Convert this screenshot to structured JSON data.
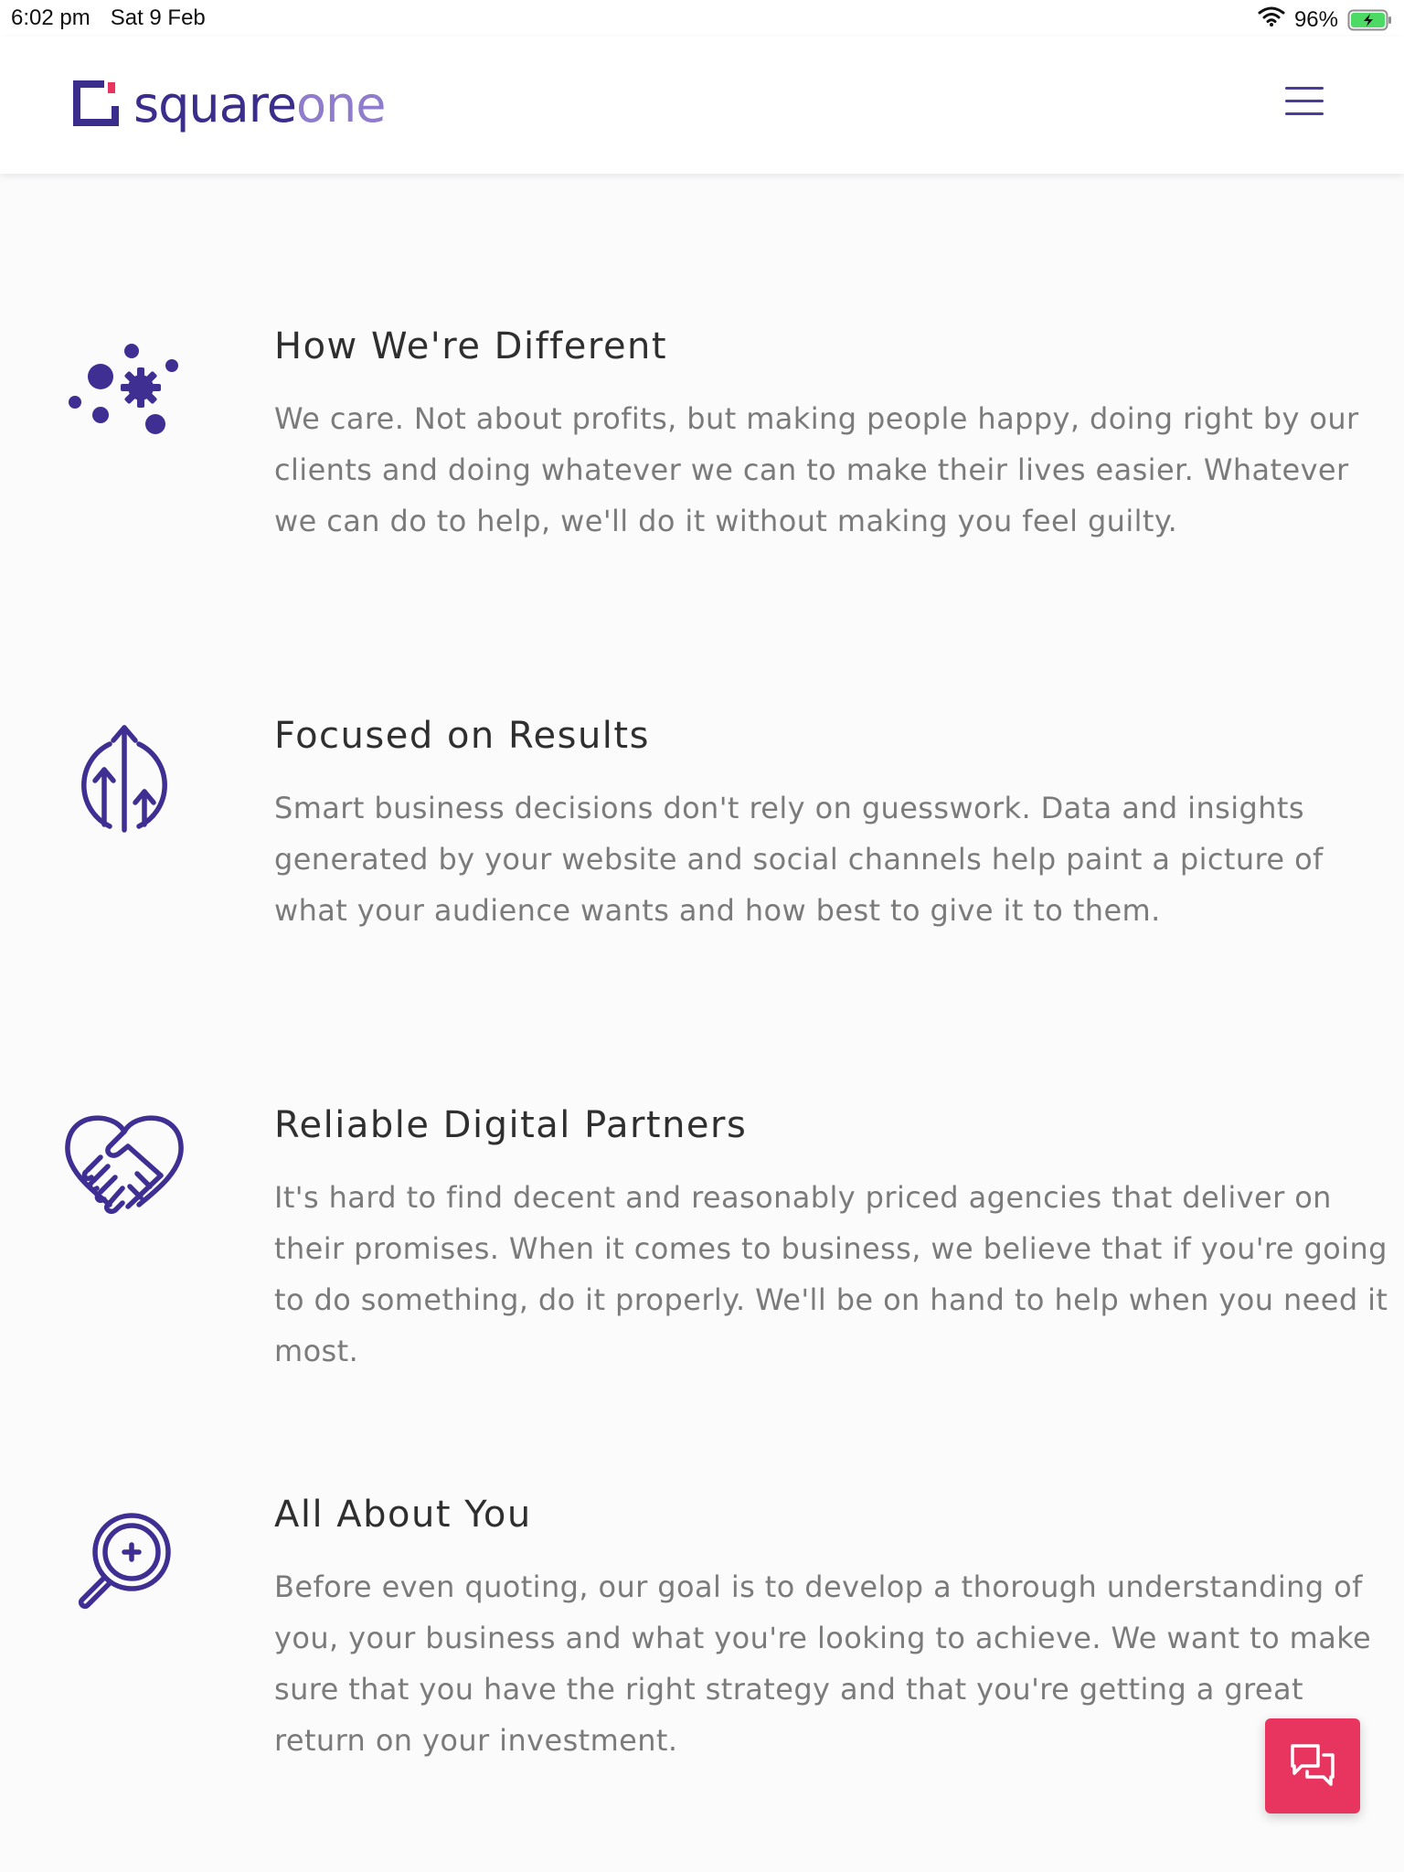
{
  "status_bar": {
    "time": "6:02 pm",
    "date": "Sat 9 Feb",
    "battery_percent": "96%",
    "battery_level": 0.96,
    "battery_charging": true
  },
  "header": {
    "logo": {
      "word1": "square",
      "word2": "one",
      "mark_color": "#3a2d8c",
      "accent_color": "#e8355f"
    },
    "menu_icon": "hamburger-icon"
  },
  "features": [
    {
      "icon": "network-dots-icon",
      "title": "How We're Different",
      "body": "We care. Not about profits, but making people happy, doing right by our clients and doing whatever we can to make their lives easier. Whatever we can do to help, we'll do it without making you feel guilty."
    },
    {
      "icon": "growth-arrows-icon",
      "title": "Focused on Results",
      "body": "Smart business decisions don't rely on guesswork. Data and insights generated by your website and social channels help paint a picture of what your audience wants and how best to give it to them."
    },
    {
      "icon": "heart-handshake-icon",
      "title": "Reliable Digital Partners",
      "body": "It's hard to find decent and reasonably priced agencies that deliver on their promises. When it comes to business, we believe that if you're going to do something, do it properly. We'll be on hand to help when you need it most."
    },
    {
      "icon": "magnifier-plus-icon",
      "title": "All About You",
      "body": "Before even quoting, our goal is to develop a thorough understanding of you, your business and what you're looking to achieve. We want to make sure that you have the right strategy and that you're getting a great return on your investment."
    }
  ],
  "chat_button": {
    "icon": "chat-bubbles-icon",
    "color": "#e8355f"
  },
  "colors": {
    "brand_purple": "#3f2f93",
    "text_heading": "#2f2f2f",
    "text_body": "#7b7b7b",
    "background": "#fbfbfc"
  }
}
